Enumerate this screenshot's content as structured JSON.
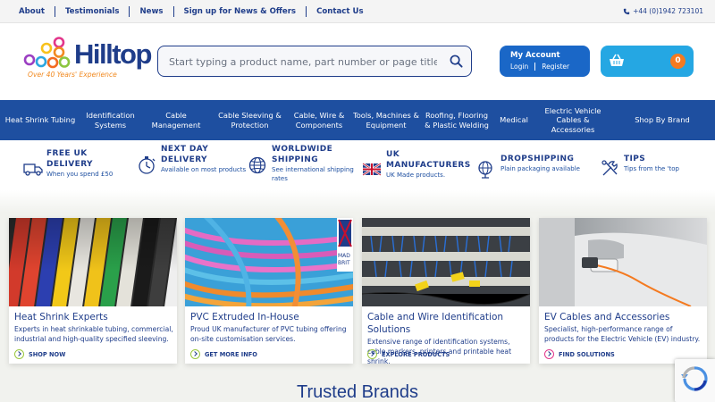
{
  "topbar": {
    "links": [
      "About",
      "Testimonials",
      "News",
      "Sign up for News & Offers",
      "Contact Us"
    ],
    "phone": "+44 (0)1942 723101"
  },
  "logo": {
    "name": "Hilltop",
    "tagline": "Over 40 Years' Experience"
  },
  "search": {
    "placeholder": "Start typing a product name, part number or page title"
  },
  "account": {
    "title": "My Account",
    "login": "Login",
    "register": "Register"
  },
  "basket": {
    "count": "0"
  },
  "mainnav": [
    "Heat Shrink Tubing",
    "Identification Systems",
    "Cable Management",
    "Cable Sleeving & Protection",
    "Cable, Wire & Components",
    "Tools, Machines & Equipment",
    "Roofing, Flooring & Plastic Welding",
    "Medical",
    "Electric Vehicle Cables & Accessories",
    "Shop By Brand"
  ],
  "usp": [
    {
      "icon": "delivery-truck-icon",
      "title": "FREE UK DELIVERY",
      "sub": "When you spend £50"
    },
    {
      "icon": "stopwatch-icon",
      "title": "NEXT DAY DELIVERY",
      "sub": "Available on most products"
    },
    {
      "icon": "globe-icon",
      "title": "WORLDWIDE SHIPPING",
      "sub": "See international shipping rates"
    },
    {
      "icon": "uk-flag-icon",
      "title": "UK MANUFACTURERS",
      "sub": "UK Made products."
    },
    {
      "icon": "pin-globe-icon",
      "title": "DROPSHIPPING",
      "sub": "Plain packaging available"
    },
    {
      "icon": "tips-tools-icon",
      "title": "TIPS",
      "sub": "Tips from the 'top"
    }
  ],
  "cards": [
    {
      "title": "Heat Shrink Experts",
      "desc": "Experts in heat shrinkable tubing, commercial, industrial and high-quality specified sleeving.",
      "link": "SHOP NOW"
    },
    {
      "title": "PVC Extruded In-House",
      "desc": "Proud UK manufacturer of PVC tubing offering on-site customisation services.",
      "link": "GET MORE INFO"
    },
    {
      "title": "Cable and Wire Identification Solutions",
      "desc": "Extensive range of identification systems, cable markers, printers and printable heat shrink.",
      "link": "EXPLORE PRODUCTS"
    },
    {
      "title": "EV Cables and Accessories",
      "desc": "Specialist, high-performance range of products for the Electric Vehicle (EV) industry.",
      "link": "FIND SOLUTIONS"
    }
  ],
  "trusted": "Trusted Brands",
  "colors": {
    "navy": "#1f3d8a",
    "nav_blue": "#1e4fa0",
    "account_blue": "#1a67c7",
    "basket_blue": "#25a7e3",
    "orange": "#f47a20"
  }
}
